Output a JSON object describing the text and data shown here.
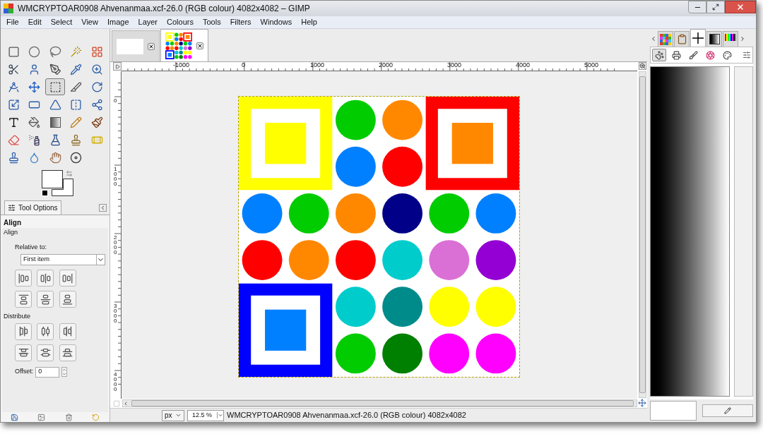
{
  "window": {
    "title": "WMCRYPTOAR0908 Ahvenanmaa.xcf-26.0 (RGB colour) 4082x4082 – GIMP"
  },
  "menu": [
    "File",
    "Edit",
    "Select",
    "View",
    "Image",
    "Layer",
    "Colours",
    "Tools",
    "Filters",
    "Windows",
    "Help"
  ],
  "toolbox": {
    "tools": [
      {
        "selected": false
      },
      {
        "selected": false
      },
      {
        "selected": false
      },
      {
        "selected": false
      },
      {
        "selected": false
      },
      {
        "selected": false
      },
      {
        "selected": false
      },
      {
        "selected": false
      },
      {
        "selected": false
      },
      {
        "selected": false
      },
      {
        "selected": false
      },
      {
        "selected": false
      },
      {
        "selected": true
      },
      {
        "selected": false
      },
      {
        "selected": false
      },
      {
        "selected": false
      },
      {
        "selected": false
      },
      {
        "selected": false
      },
      {
        "selected": false
      },
      {
        "selected": false
      },
      {
        "selected": false
      },
      {
        "selected": false
      },
      {
        "selected": false
      },
      {
        "selected": false
      },
      {
        "selected": false
      },
      {
        "selected": false
      },
      {
        "selected": false
      },
      {
        "selected": false
      },
      {
        "selected": false
      },
      {
        "selected": false
      },
      {
        "selected": false
      },
      {
        "selected": false
      },
      {
        "selected": false
      },
      {
        "selected": false
      }
    ]
  },
  "tool_options": {
    "tab": "Tool Options",
    "title": "Align",
    "group": "Align",
    "relative_label": "Relative to:",
    "relative_value": "First item",
    "distribute_label": "Distribute",
    "offset_label": "Offset:",
    "offset_value": "0"
  },
  "image_tabs": [
    {
      "kind": "blank",
      "selected": false
    },
    {
      "kind": "image",
      "selected": true
    }
  ],
  "rulers": {
    "horizontal": [
      "-1000",
      "0",
      "1000",
      "2000",
      "3000",
      "4000",
      "5000"
    ],
    "vertical": [
      "0",
      "1000",
      "2000",
      "3000",
      "4000"
    ]
  },
  "canvas": {
    "frames": [
      {
        "color": "#ffff00"
      },
      {
        "color": "#ff0000"
      },
      {
        "color": "#0000ff"
      }
    ],
    "squares": [
      {
        "color": "#ffff00"
      },
      {
        "color": "#ff8800"
      },
      {
        "color": "#0080ff"
      }
    ],
    "circles": [
      {
        "color": "#00cc00"
      },
      {
        "color": "#ff8800"
      },
      {
        "color": "#0080ff"
      },
      {
        "color": "#ff0000"
      },
      {
        "color": "#0080ff"
      },
      {
        "color": "#00cc00"
      },
      {
        "color": "#ff8800"
      },
      {
        "color": "#000088"
      },
      {
        "color": "#00cc00"
      },
      {
        "color": "#0080ff"
      },
      {
        "color": "#ff0000"
      },
      {
        "color": "#ff8800"
      },
      {
        "color": "#ff0000"
      },
      {
        "color": "#00cccc"
      },
      {
        "color": "#da70d6"
      },
      {
        "color": "#9400d3"
      },
      {
        "color": "#00cccc"
      },
      {
        "color": "#008b8b"
      },
      {
        "color": "#ffff00"
      },
      {
        "color": "#ffff00"
      },
      {
        "color": "#00cc00"
      },
      {
        "color": "#008000"
      },
      {
        "color": "#ff00ff"
      },
      {
        "color": "#ff00ff"
      }
    ]
  },
  "status_bar": {
    "unit": "px",
    "zoom": "12.5 %",
    "text": "WMCRYPTOAR0908 Ahvenanmaa.xcf-26.0 (RGB colour) 4082x4082"
  },
  "dock": {
    "tabs": [
      {
        "selected": false
      },
      {
        "selected": false
      },
      {
        "selected": true
      },
      {
        "selected": false
      },
      {
        "selected": false
      }
    ],
    "buttons": [
      {
        "selected": true
      },
      {
        "selected": false
      },
      {
        "selected": false
      },
      {
        "selected": false
      },
      {
        "selected": false
      }
    ]
  }
}
